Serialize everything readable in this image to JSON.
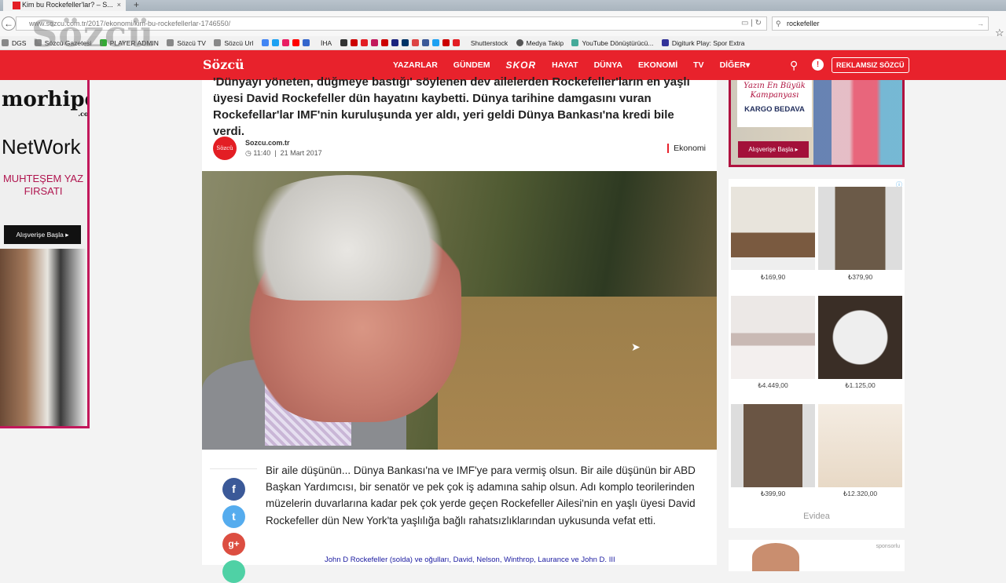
{
  "browser": {
    "tab_title": "Kim bu Rockefeller'lar? – S...",
    "url": "www.sozcu.com.tr/2017/ekonomi/kim-bu-rockefellerlar-1746550/",
    "search_value": "rockefeller",
    "bookmarks": [
      "DGS",
      "Sözcü Gazetesi",
      "PLAYER ADMIN",
      "Sözcü TV",
      "Sözcü Url",
      "İHA",
      "Shutterstock",
      "Medya Takip",
      "YouTube Dönüştürücü...",
      "Digiturk Play: Spor Extra"
    ],
    "watermark": "Sözcü"
  },
  "site": {
    "logo": "Sözcü",
    "menu": [
      "YAZARLAR",
      "GÜNDEM",
      "SKOR",
      "HAYAT",
      "DÜNYA",
      "EKONOMİ",
      "TV",
      "DİĞER▾"
    ],
    "ad_free_button": "REKLAMSIZ SÖZCÜ",
    "brand_color": "#e8222c"
  },
  "article": {
    "lead": "'Dünyayı yöneten, düğmeye bastığı' söylenen dev ailelerden Rockefeller'ların en yaşlı üyesi David Rockefeller dün hayatını kaybetti. Dünya tarihine damgasını vuran Rockefellar'lar IMF'nin kuruluşunda yer aldı, yeri geldi Dünya Bankası'na kredi bile verdi.",
    "avatar": "Sözcü",
    "source": "Sozcu.com.tr",
    "time": "11:40",
    "date": "21 Mart 2017",
    "category": "Ekonomi",
    "body": "Bir aile düşünün... Dünya Bankası'na ve IMF'ye para vermiş olsun. Bir aile düşünün bir ABD Başkan Yardımcısı, bir senatör ve pek çok iş adamına sahip olsun. Adı komplo teorilerinden müzelerin duvarlarına kadar pek çok yerde geçen Rockefeller Ailesi'nin en yaşlı üyesi David Rockefeller dün New York'ta yaşlılığa bağlı rahatsızlıklarından uykusunda vefat etti.",
    "caption": "John D Rockefeller (solda) ve oğulları, David, Nelson, Winthrop, Laurance ve John D. III",
    "share": {
      "facebook": "f",
      "twitter": "t",
      "googleplus": "g+"
    }
  },
  "left_ad": {
    "brand": "morhipo",
    "brand_suffix": ".com",
    "title": "NetWork",
    "promo": "MUHTEŞEM YAZ FIRSATI",
    "cta": "Alışverişe Başla ▸"
  },
  "right_ad": {
    "headline": "Yazın En Büyük Kampanyası",
    "sub": "KARGO BEDAVA",
    "cta": "Alışverişe Başla ▸"
  },
  "evidea": {
    "prices": [
      "₺169,90",
      "₺379,90",
      "₺4.449,00",
      "₺1.125,00",
      "₺399,90",
      "₺12.320,00"
    ],
    "brand": "Evidea",
    "info": "ⓘ"
  },
  "sponsor": {
    "label": "sponsorlu"
  }
}
